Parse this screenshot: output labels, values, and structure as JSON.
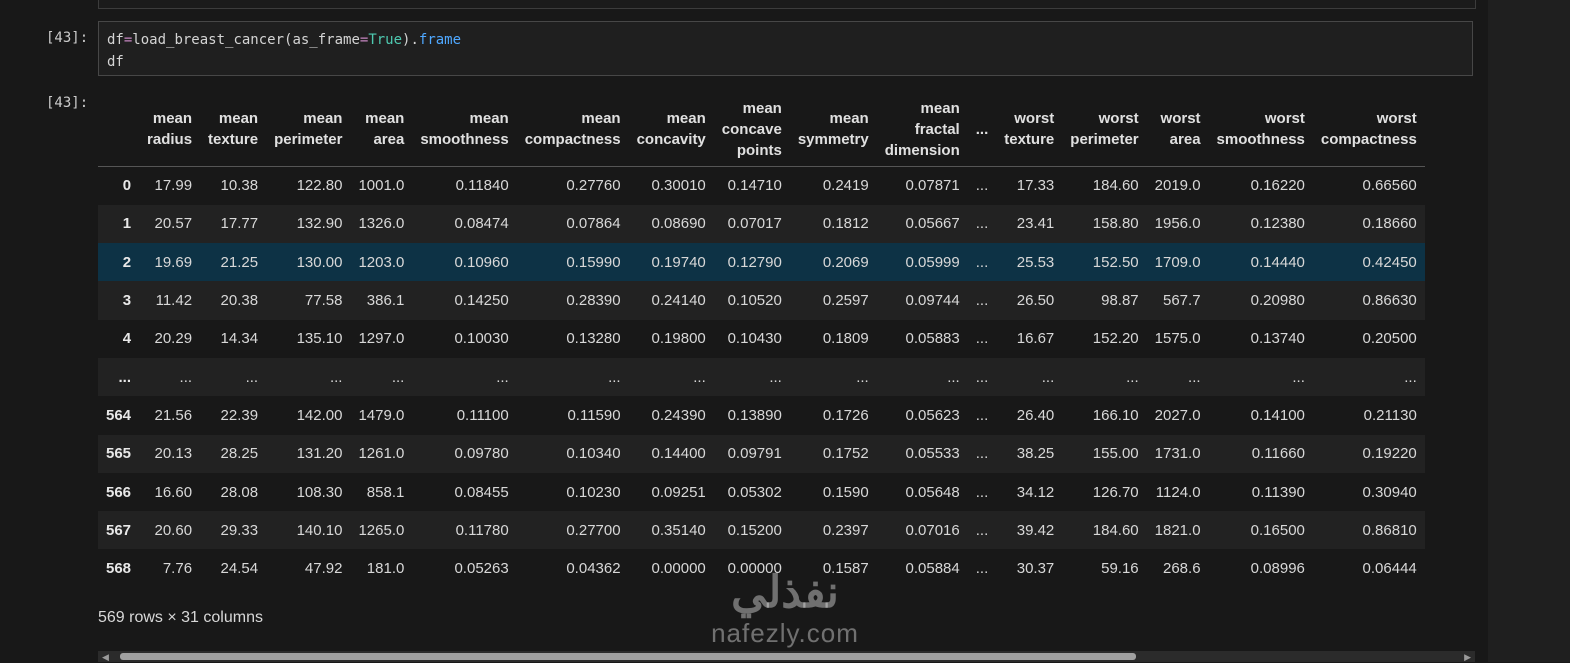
{
  "cell_in": {
    "prompt": "[43]:",
    "line1": {
      "var": "df",
      "op": "=",
      "func": "load_breast_cancer(as_frame",
      "op2": "=",
      "kw": "True",
      "close": ").",
      "attr": "frame"
    },
    "line2": "df"
  },
  "cell_out": {
    "prompt": "[43]:"
  },
  "table": {
    "columns": [
      [
        "mean",
        "radius"
      ],
      [
        "mean",
        "texture"
      ],
      [
        "mean",
        "perimeter"
      ],
      [
        "mean",
        "area"
      ],
      [
        "mean",
        "smoothness"
      ],
      [
        "mean",
        "compactness"
      ],
      [
        "mean",
        "concavity"
      ],
      [
        "mean",
        "concave",
        "points"
      ],
      [
        "mean",
        "symmetry"
      ],
      [
        "mean",
        "fractal",
        "dimension"
      ],
      [
        "..."
      ],
      [
        "worst",
        "texture"
      ],
      [
        "worst",
        "perimeter"
      ],
      [
        "worst",
        "area"
      ],
      [
        "worst",
        "smoothness"
      ],
      [
        "worst",
        "compactness"
      ]
    ],
    "rows": [
      {
        "index": "0",
        "values": [
          "17.99",
          "10.38",
          "122.80",
          "1001.0",
          "0.11840",
          "0.27760",
          "0.30010",
          "0.14710",
          "0.2419",
          "0.07871",
          "...",
          "17.33",
          "184.60",
          "2019.0",
          "0.16220",
          "0.66560"
        ]
      },
      {
        "index": "1",
        "values": [
          "20.57",
          "17.77",
          "132.90",
          "1326.0",
          "0.08474",
          "0.07864",
          "0.08690",
          "0.07017",
          "0.1812",
          "0.05667",
          "...",
          "23.41",
          "158.80",
          "1956.0",
          "0.12380",
          "0.18660"
        ]
      },
      {
        "index": "2",
        "values": [
          "19.69",
          "21.25",
          "130.00",
          "1203.0",
          "0.10960",
          "0.15990",
          "0.19740",
          "0.12790",
          "0.2069",
          "0.05999",
          "...",
          "25.53",
          "152.50",
          "1709.0",
          "0.14440",
          "0.42450"
        ]
      },
      {
        "index": "3",
        "values": [
          "11.42",
          "20.38",
          "77.58",
          "386.1",
          "0.14250",
          "0.28390",
          "0.24140",
          "0.10520",
          "0.2597",
          "0.09744",
          "...",
          "26.50",
          "98.87",
          "567.7",
          "0.20980",
          "0.86630"
        ]
      },
      {
        "index": "4",
        "values": [
          "20.29",
          "14.34",
          "135.10",
          "1297.0",
          "0.10030",
          "0.13280",
          "0.19800",
          "0.10430",
          "0.1809",
          "0.05883",
          "...",
          "16.67",
          "152.20",
          "1575.0",
          "0.13740",
          "0.20500"
        ]
      },
      {
        "index": "...",
        "values": [
          "...",
          "...",
          "...",
          "...",
          "...",
          "...",
          "...",
          "...",
          "...",
          "...",
          "...",
          "...",
          "...",
          "...",
          "...",
          "..."
        ]
      },
      {
        "index": "564",
        "values": [
          "21.56",
          "22.39",
          "142.00",
          "1479.0",
          "0.11100",
          "0.11590",
          "0.24390",
          "0.13890",
          "0.1726",
          "0.05623",
          "...",
          "26.40",
          "166.10",
          "2027.0",
          "0.14100",
          "0.21130"
        ]
      },
      {
        "index": "565",
        "values": [
          "20.13",
          "28.25",
          "131.20",
          "1261.0",
          "0.09780",
          "0.10340",
          "0.14400",
          "0.09791",
          "0.1752",
          "0.05533",
          "...",
          "38.25",
          "155.00",
          "1731.0",
          "0.11660",
          "0.19220"
        ]
      },
      {
        "index": "566",
        "values": [
          "16.60",
          "28.08",
          "108.30",
          "858.1",
          "0.08455",
          "0.10230",
          "0.09251",
          "0.05302",
          "0.1590",
          "0.05648",
          "...",
          "34.12",
          "126.70",
          "1124.0",
          "0.11390",
          "0.30940"
        ]
      },
      {
        "index": "567",
        "values": [
          "20.60",
          "29.33",
          "140.10",
          "1265.0",
          "0.11780",
          "0.27700",
          "0.35140",
          "0.15200",
          "0.2397",
          "0.07016",
          "...",
          "39.42",
          "184.60",
          "1821.0",
          "0.16500",
          "0.86810"
        ]
      },
      {
        "index": "568",
        "values": [
          "7.76",
          "24.54",
          "47.92",
          "181.0",
          "0.05263",
          "0.04362",
          "0.00000",
          "0.00000",
          "0.1587",
          "0.05884",
          "...",
          "30.37",
          "59.16",
          "268.6",
          "0.08996",
          "0.06444"
        ]
      }
    ],
    "highlighted_row": "2"
  },
  "footer": "569 rows × 31 columns",
  "watermark": {
    "logo": "نفذلي",
    "site": "nafezly.com"
  },
  "colors": {
    "background": "#181818",
    "row_highlight": "#0d3245",
    "keyword": "#4ec9b0",
    "attribute": "#4fa8ff",
    "operator": "#c586c0"
  }
}
